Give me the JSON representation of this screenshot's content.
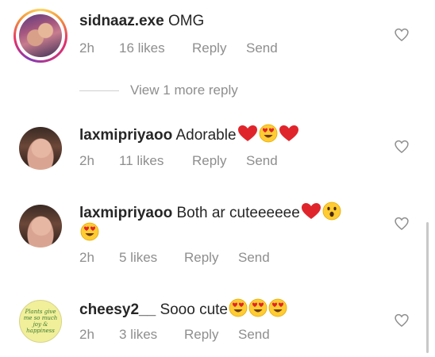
{
  "comments": [
    {
      "username": "sidnaaz.exe",
      "text": "OMG",
      "emojis": [],
      "emojis_line2": [],
      "time": "2h",
      "likes": "16 likes",
      "reply": "Reply",
      "send": "Send",
      "avatar": "couple-photo",
      "has_story_ring": true
    },
    {
      "username": "laxmipriyaoo",
      "text": "Adorable",
      "emojis": [
        "red-heart",
        "heart-eyes",
        "red-heart"
      ],
      "emojis_line2": [],
      "time": "2h",
      "likes": "11 likes",
      "reply": "Reply",
      "send": "Send",
      "avatar": "girl-selfie",
      "has_story_ring": false
    },
    {
      "username": "laxmipriyaoo",
      "text": "Both ar cuteeeeee",
      "emojis": [
        "red-heart",
        "astonished-face"
      ],
      "emojis_line2": [
        "heart-eyes"
      ],
      "time": "2h",
      "likes": "5 likes",
      "reply": "Reply",
      "send": "Send",
      "avatar": "girl-selfie",
      "has_story_ring": false
    },
    {
      "username": "cheesy2__",
      "text": "Sooo cute",
      "emojis": [
        "heart-eyes",
        "heart-eyes",
        "heart-eyes"
      ],
      "emojis_line2": [],
      "time": "2h",
      "likes": "3 likes",
      "reply": "Reply",
      "send": "Send",
      "avatar": "plants-quote",
      "avatar_text": "Plants give me so much joy & happiness",
      "has_story_ring": false
    }
  ],
  "view_more": "View 1 more reply",
  "colors": {
    "text": "#262626",
    "meta": "#8e8e8e",
    "heart": "#e0242b",
    "emoji_face": "#ffcc33"
  }
}
